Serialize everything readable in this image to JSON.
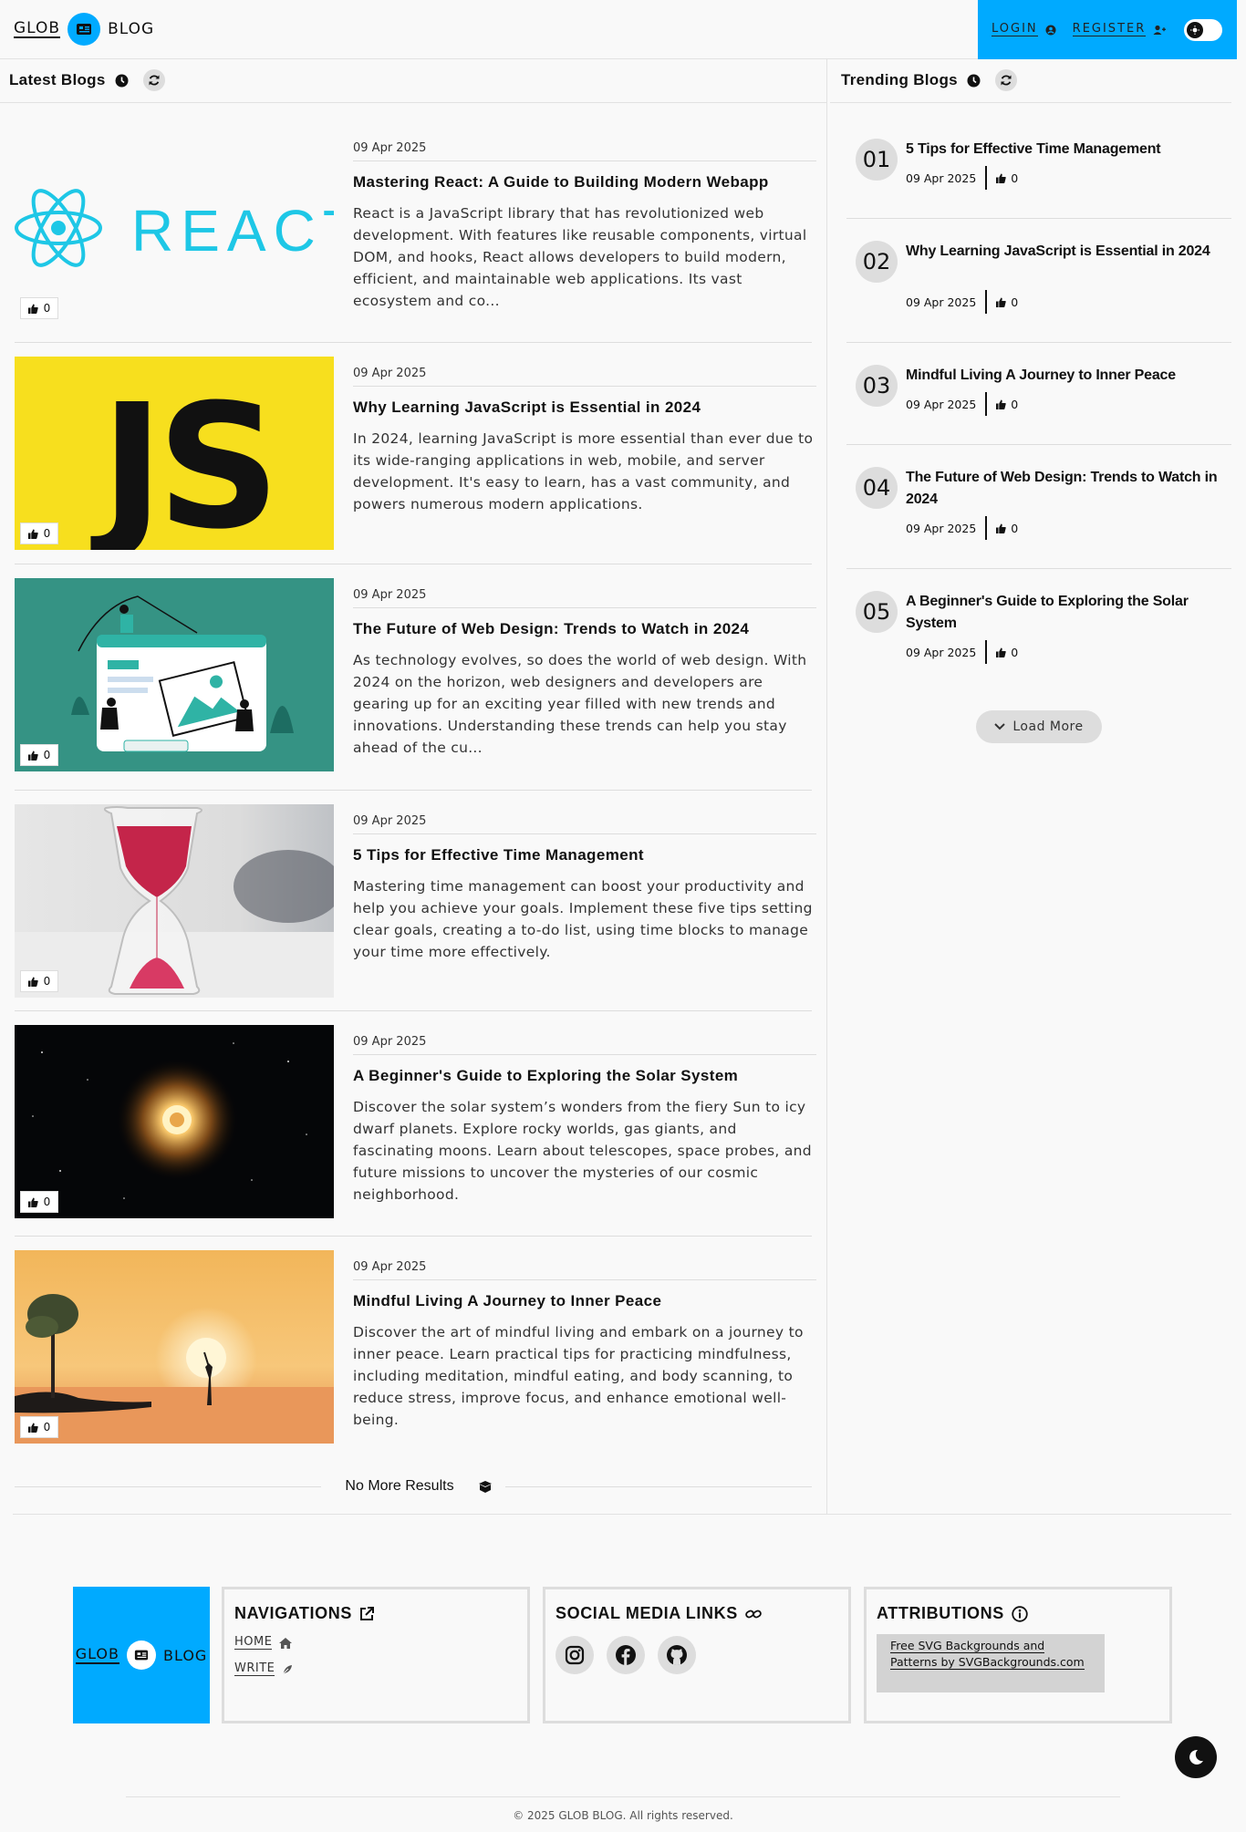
{
  "brand": {
    "left": "GLOB",
    "right": "BLOG",
    "color": "#00aaff"
  },
  "header": {
    "login": "LOGIN",
    "register": "REGISTER"
  },
  "latest": {
    "title": "Latest Blogs"
  },
  "trending": {
    "title": "Trending Blogs",
    "load_more": "Load More"
  },
  "posts": [
    {
      "date": "09 Apr 2025",
      "title": "Mastering React: A Guide to Building Modern Webapp",
      "excerpt": "React is a JavaScript library that has revolutionized web development. With features like reusable components, virtual DOM, and hooks, React allows developers to build modern, efficient, and maintainable web applications. Its vast ecosystem and co...",
      "likes": "0",
      "image_text": "REACT"
    },
    {
      "date": "09 Apr 2025",
      "title": "Why Learning JavaScript is Essential in 2024",
      "excerpt": "In 2024, learning JavaScript is more essential than ever due to its wide-ranging applications in web, mobile, and server development. It's easy to learn, has a vast community, and powers numerous modern applications.",
      "likes": "0",
      "image_text": "JS"
    },
    {
      "date": "09 Apr 2025",
      "title": "The Future of Web Design: Trends to Watch in 2024",
      "excerpt": "As technology evolves, so does the world of web design. With 2024 on the horizon, web designers and developers are gearing up for an exciting year filled with new trends and innovations. Understanding these trends can help you stay ahead of the cu...",
      "likes": "0"
    },
    {
      "date": "09 Apr 2025",
      "title": "5 Tips for Effective Time Management",
      "excerpt": "Mastering time management can boost your productivity and help you achieve your goals. Implement these five tips setting clear goals, creating a to-do list, using time blocks to manage your time more effectively.",
      "likes": "0"
    },
    {
      "date": "09 Apr 2025",
      "title": "A Beginner's Guide to Exploring the Solar System",
      "excerpt": "Discover the solar system’s wonders from the fiery Sun to icy dwarf planets. Explore rocky worlds, gas giants, and fascinating moons. Learn about telescopes, space probes, and future missions to uncover the mysteries of our cosmic neighborhood.",
      "likes": "0"
    },
    {
      "date": "09 Apr 2025",
      "title": "Mindful Living A Journey to Inner Peace",
      "excerpt": "Discover the art of mindful living and embark on a journey to inner peace. Learn practical tips for practicing mindfulness, including meditation, mindful eating, and body scanning, to reduce stress, improve focus, and enhance emotional well-being.",
      "likes": "0"
    }
  ],
  "no_more": "No More Results",
  "trend_items": [
    {
      "num": "01",
      "title": "5 Tips for Effective Time Management",
      "date": "09 Apr 2025",
      "likes": "0"
    },
    {
      "num": "02",
      "title": "Why Learning JavaScript is Essential in 2024",
      "date": "09 Apr 2025",
      "likes": "0"
    },
    {
      "num": "03",
      "title": "Mindful Living A Journey to Inner Peace",
      "date": "09 Apr 2025",
      "likes": "0"
    },
    {
      "num": "04",
      "title": "The Future of Web Design: Trends to Watch in 2024",
      "date": "09 Apr 2025",
      "likes": "0"
    },
    {
      "num": "05",
      "title": "A Beginner's Guide to Exploring the Solar System",
      "date": "09 Apr 2025",
      "likes": "0"
    }
  ],
  "footer": {
    "nav_title": "NAVIGATIONS",
    "nav_home": "HOME",
    "nav_write": "WRITE",
    "social_title": "SOCIAL MEDIA LINKS",
    "socials": [
      "instagram-icon",
      "facebook-icon",
      "github-icon"
    ],
    "attr_title": "ATTRIBUTIONS",
    "attr_text": "Free SVG Backgrounds and Patterns by SVGBackgrounds.com",
    "copyright": "© 2025 GLOB BLOG. All rights reserved."
  }
}
